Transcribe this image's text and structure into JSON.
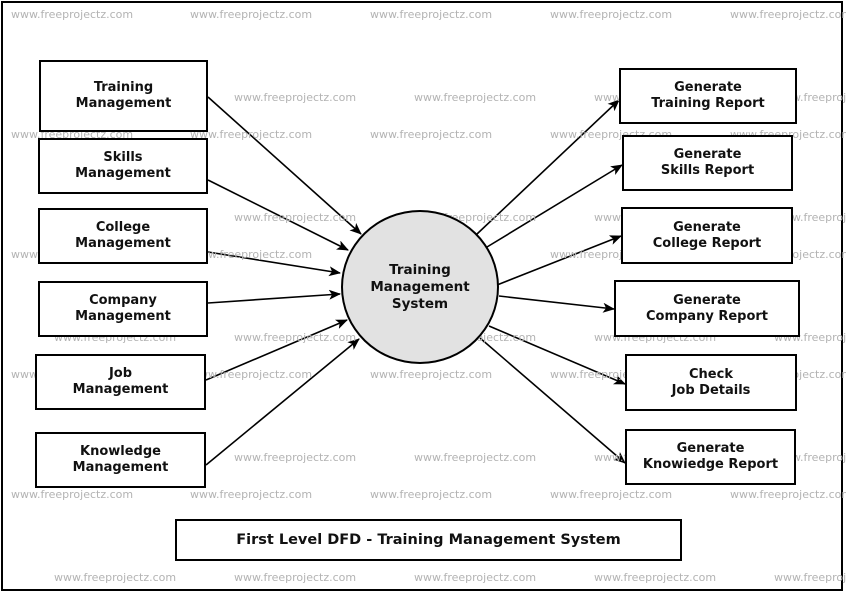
{
  "diagram": {
    "type": "data-flow-diagram",
    "level": "First Level",
    "title": "First Level DFD - Training Management System",
    "process": {
      "label": "Training\nManagement\nSystem",
      "fill": "#e2e2e2"
    },
    "inputs": [
      {
        "id": "training-management",
        "label": "Training\nManagement"
      },
      {
        "id": "skills-management",
        "label": "Skills\nManagement"
      },
      {
        "id": "college-management",
        "label": "College\nManagement"
      },
      {
        "id": "company-management",
        "label": "Company\nManagement"
      },
      {
        "id": "job-management",
        "label": "Job\nManagement"
      },
      {
        "id": "knowledge-management",
        "label": "Knowledge\nManagement"
      }
    ],
    "outputs": [
      {
        "id": "generate-training-report",
        "label": "Generate\nTraining Report"
      },
      {
        "id": "generate-skills-report",
        "label": "Generate\nSkills Report"
      },
      {
        "id": "generate-college-report",
        "label": "Generate\nCollege Report"
      },
      {
        "id": "generate-company-report",
        "label": "Generate\nCompany Report"
      },
      {
        "id": "check-job-details",
        "label": "Check\nJob Details"
      },
      {
        "id": "generate-knowledge-report",
        "label": "Generate\nKnowiedge Report"
      }
    ],
    "flows": [
      {
        "from": "training-management",
        "to": "process"
      },
      {
        "from": "skills-management",
        "to": "process"
      },
      {
        "from": "college-management",
        "to": "process"
      },
      {
        "from": "company-management",
        "to": "process"
      },
      {
        "from": "job-management",
        "to": "process"
      },
      {
        "from": "knowledge-management",
        "to": "process"
      },
      {
        "from": "process",
        "to": "generate-training-report"
      },
      {
        "from": "process",
        "to": "generate-skills-report"
      },
      {
        "from": "process",
        "to": "generate-college-report"
      },
      {
        "from": "process",
        "to": "generate-company-report"
      },
      {
        "from": "process",
        "to": "check-job-details"
      },
      {
        "from": "process",
        "to": "generate-knowledge-report"
      }
    ]
  },
  "watermark": {
    "text": "www.freeprojectz.com",
    "color": "#b3b3b3"
  }
}
